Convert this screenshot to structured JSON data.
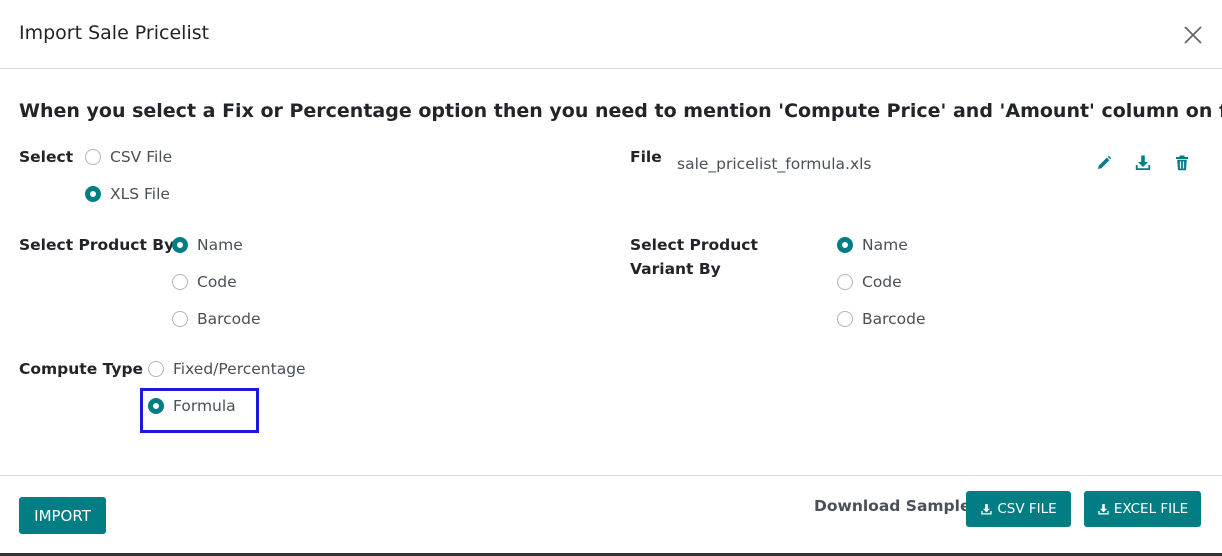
{
  "dialog": {
    "title": "Import Sale Pricelist",
    "close_icon": "close-icon"
  },
  "note": "When you select a Fix or Percentage option then you need to mention 'Compute Price' and 'Amount' column on file.",
  "select": {
    "label": "Select",
    "options": [
      {
        "label": "CSV File",
        "checked": false
      },
      {
        "label": "XLS File",
        "checked": true
      }
    ]
  },
  "file": {
    "label": "File",
    "name": "sale_pricelist_formula.xls",
    "icons": [
      "edit-icon",
      "download-icon",
      "trash-icon"
    ]
  },
  "product_by": {
    "label": "Select Product By",
    "options": [
      {
        "label": "Name",
        "checked": true
      },
      {
        "label": "Code",
        "checked": false
      },
      {
        "label": "Barcode",
        "checked": false
      }
    ]
  },
  "variant_by": {
    "label": "Select Product Variant By",
    "options": [
      {
        "label": "Name",
        "checked": true
      },
      {
        "label": "Code",
        "checked": false
      },
      {
        "label": "Barcode",
        "checked": false
      }
    ]
  },
  "compute_type": {
    "label": "Compute Type",
    "options": [
      {
        "label": "Fixed/Percentage",
        "checked": false
      },
      {
        "label": "Formula",
        "checked": true
      }
    ]
  },
  "footer": {
    "import_label": "IMPORT",
    "download_label": "Download Sample:",
    "csv_label": "CSV FILE",
    "excel_label": "EXCEL FILE"
  },
  "colors": {
    "accent": "#017e84",
    "highlight": "#1a1add"
  }
}
